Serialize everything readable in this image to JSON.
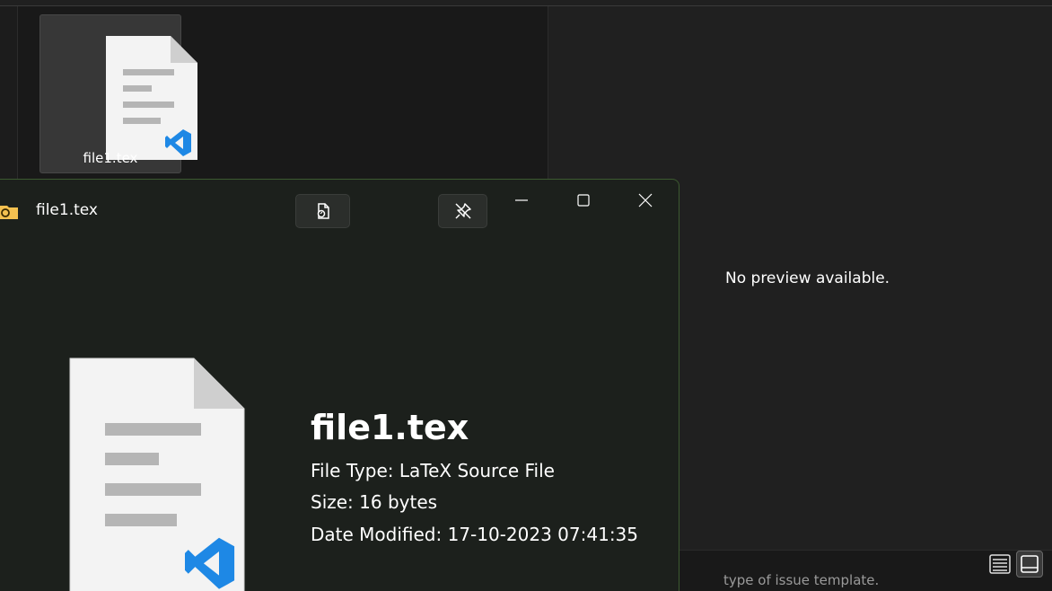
{
  "explorer": {
    "tile_label": "file1.tex",
    "preview_message": "No preview available.",
    "status_peek_text": "type of issue template.",
    "view_buttons": [
      "details-view-icon",
      "tiles-view-icon"
    ]
  },
  "peek": {
    "title": "file1.tex",
    "toolbar": [
      "open-with-icon",
      "pin-icon"
    ],
    "window_controls": [
      "minimize-icon",
      "maximize-icon",
      "close-icon"
    ],
    "file": {
      "name": "file1.tex",
      "type_line": "File Type: LaTeX Source File",
      "size_line": "Size: 16 bytes",
      "date_line": "Date Modified: 17-10-2023 07:41:35"
    }
  },
  "colors": {
    "vscode_blue": "#1e88e5",
    "peek_border": "#3c5a30",
    "folder_yellow": "#f4c150"
  }
}
